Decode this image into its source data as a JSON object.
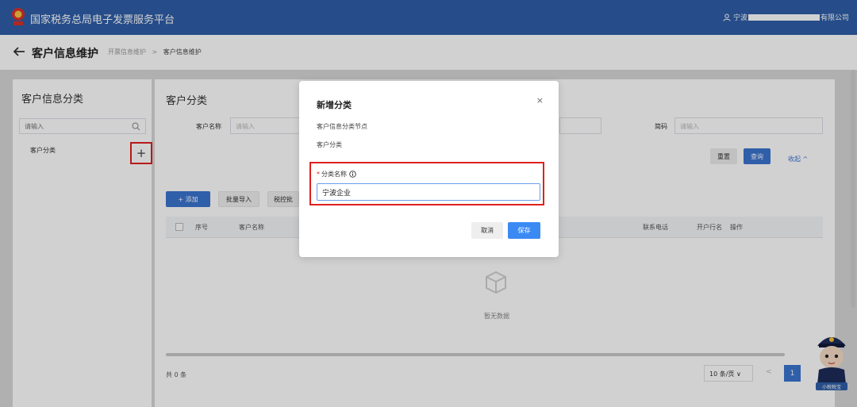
{
  "header": {
    "app_title": "国家税务总局电子发票服务平台",
    "user_prefix": "宁波",
    "user_suffix": "有限公司",
    "emblem_caption": "税务"
  },
  "nav": {
    "page_title": "客户信息维护",
    "breadcrumbs": [
      "开票信息维护",
      "客户信息维护"
    ],
    "separator": ">"
  },
  "left_panel": {
    "title": "客户信息分类",
    "search_placeholder": "请输入",
    "tree_items": [
      "客户分类"
    ],
    "add_symbol": "+"
  },
  "main": {
    "title": "客户分类",
    "filters": {
      "customer_name_label": "客户名称",
      "customer_name_placeholder": "请输入",
      "short_name_label": "简码",
      "short_name_placeholder": "请输入"
    },
    "reset_label": "重置",
    "query_label": "查询",
    "collapse_label": "收起 ^",
    "add_label": "+ 添加",
    "import_label": "批量导入",
    "tax_control_label": "税控批",
    "columns": [
      "序号",
      "客户名称",
      "联系电话",
      "开户行名",
      "操作"
    ],
    "empty_text": "暂无数据",
    "total_text": "共 0 条",
    "page_size": "10 条/页 ∨",
    "prev": "<",
    "current_page": "1"
  },
  "dialog": {
    "title": "新增分类",
    "close": "×",
    "node_label": "客户信息分类节点",
    "node_value": "客户分类",
    "required_mark": "*",
    "field_label": "分类名称",
    "field_value": "宁波企业",
    "cancel_label": "取消",
    "save_label": "保存"
  },
  "mascot": {
    "caption": "小税税宝"
  },
  "colors": {
    "header_blue": "#2f5ea8",
    "primary": "#3b74d0",
    "save_blue": "#3b8af4",
    "highlight_red": "#e0201f"
  }
}
